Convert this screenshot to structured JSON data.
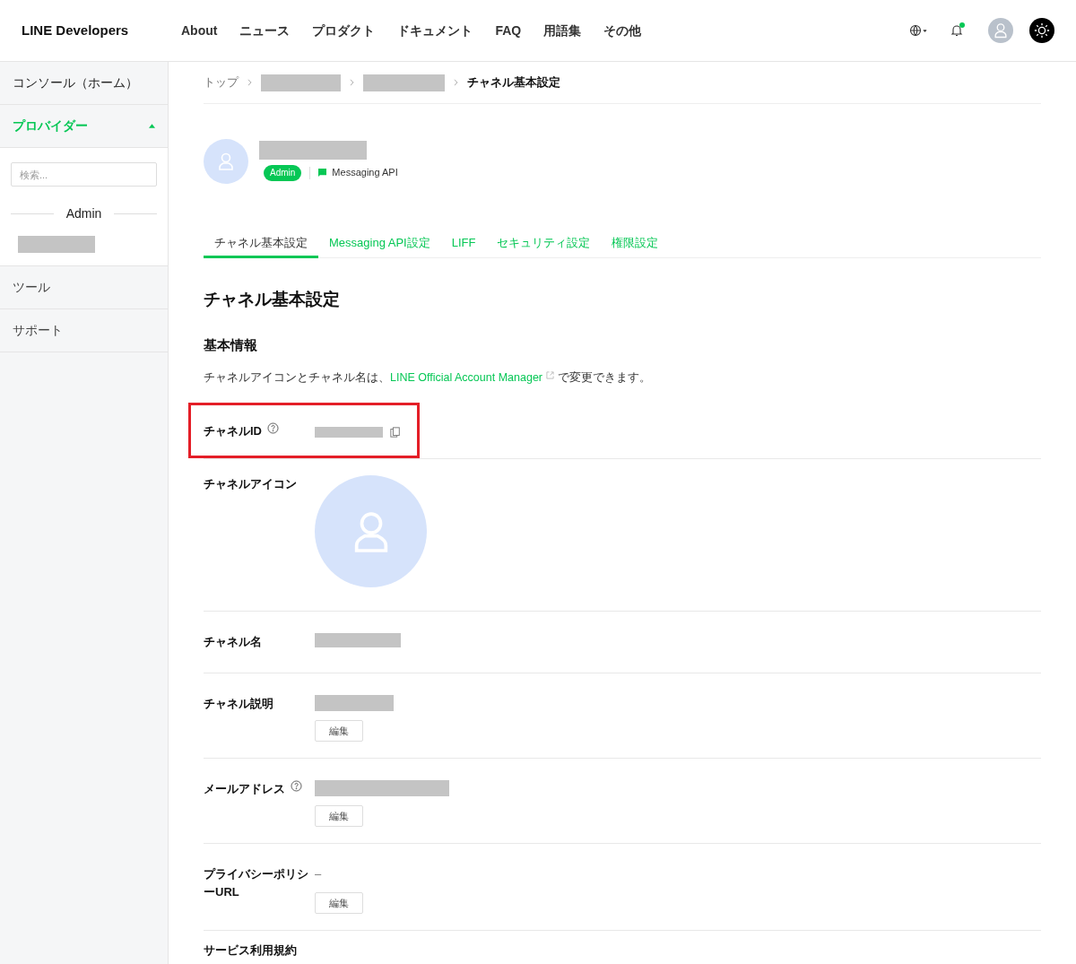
{
  "header": {
    "logo": "LINE Developers",
    "nav": [
      "About",
      "ニュース",
      "プロダクト",
      "ドキュメント",
      "FAQ",
      "用語集",
      "その他"
    ],
    "notification_unread": true
  },
  "sidebar": {
    "items": [
      {
        "kind": "link",
        "label": "コンソール（ホーム）"
      },
      {
        "kind": "section",
        "label": "プロバイダー",
        "expanded": true
      }
    ],
    "search": {
      "placeholder": "検索..."
    },
    "group_label": "Admin",
    "bottom_items": [
      "ツール",
      "サポート"
    ]
  },
  "breadcrumb": {
    "home": "トップ",
    "current": "チャネル基本設定"
  },
  "channel": {
    "role_badge": "Admin",
    "type": "Messaging API"
  },
  "tabs": [
    {
      "label": "チャネル基本設定",
      "selected": true
    },
    {
      "label": "Messaging API設定",
      "selected": false
    },
    {
      "label": "LIFF",
      "selected": false
    },
    {
      "label": "セキュリティ設定",
      "selected": false
    },
    {
      "label": "権限設定",
      "selected": false
    }
  ],
  "page_title": "チャネル基本設定",
  "section_title": "基本情報",
  "note": {
    "before": "チャネルアイコンとチャネル名は、",
    "link": "LINE Official Account Manager",
    "after": "で変更できます。"
  },
  "fields": [
    {
      "kind": "id",
      "label": "チャネルID",
      "help": true,
      "highlighted": true
    },
    {
      "kind": "icon",
      "label": "チャネルアイコン",
      "help": false,
      "highlighted": false
    },
    {
      "kind": "text",
      "label": "チャネル名",
      "help": false,
      "highlighted": false
    },
    {
      "kind": "editable",
      "label": "チャネル説明",
      "help": false,
      "highlighted": false,
      "button": "編集"
    },
    {
      "kind": "editable",
      "label": "メールアドレス",
      "help": true,
      "highlighted": false,
      "button": "編集"
    },
    {
      "kind": "empty",
      "label": "プライバシーポリシーURL",
      "help": false,
      "highlighted": false,
      "value": "–",
      "button": "編集"
    },
    {
      "kind": "heading_only",
      "label": "サービス利用規約",
      "help": false,
      "highlighted": false
    }
  ]
}
